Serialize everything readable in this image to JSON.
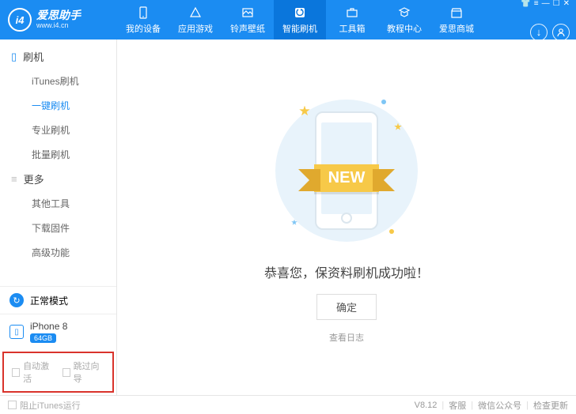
{
  "brand": {
    "logo_text": "i4",
    "name": "爱思助手",
    "url": "www.i4.cn"
  },
  "nav": [
    {
      "label": "我的设备"
    },
    {
      "label": "应用游戏"
    },
    {
      "label": "铃声壁纸"
    },
    {
      "label": "智能刷机"
    },
    {
      "label": "工具箱"
    },
    {
      "label": "教程中心"
    },
    {
      "label": "爱思商城"
    }
  ],
  "sidebar": {
    "section1": {
      "label": "刷机"
    },
    "items1": [
      "iTunes刷机",
      "一键刷机",
      "专业刷机",
      "批量刷机"
    ],
    "section2": {
      "label": "更多"
    },
    "items2": [
      "其他工具",
      "下载固件",
      "高级功能"
    ],
    "mode": {
      "label": "正常模式"
    },
    "device": {
      "name": "iPhone 8",
      "storage": "64GB"
    },
    "checks": {
      "a": "自动激活",
      "b": "跳过向导"
    }
  },
  "main": {
    "ribbon": "NEW",
    "success_text": "恭喜您，保资料刷机成功啦！",
    "confirm": "确定",
    "log_link": "查看日志"
  },
  "footer": {
    "block_itunes": "阻止iTunes运行",
    "version": "V8.12",
    "support": "客服",
    "wechat": "微信公众号",
    "update": "检查更新"
  }
}
